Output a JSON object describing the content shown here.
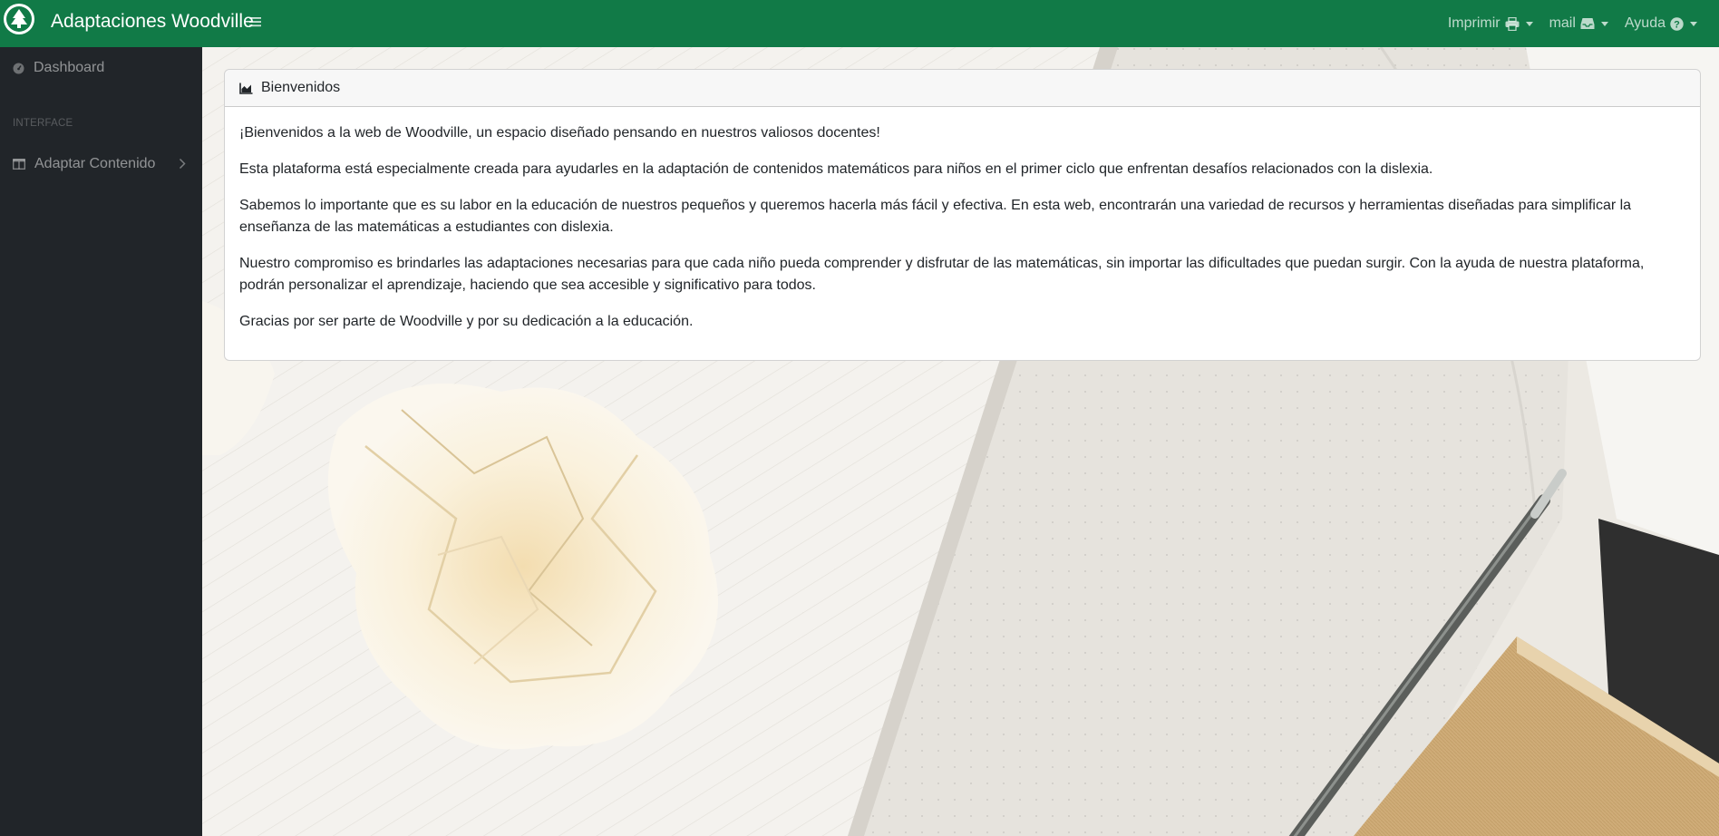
{
  "navbar": {
    "brand_title": "Adaptaciones Woodville",
    "logo_icon": "tree-logo-icon",
    "toggle_icon": "bars-icon",
    "color": "#117a47",
    "items": [
      {
        "label": "Imprimir",
        "icon": "printer-icon"
      },
      {
        "label": "mail",
        "icon": "inbox-icon"
      },
      {
        "label": "Ayuda",
        "icon": "question-circle-icon"
      }
    ]
  },
  "sidebar": {
    "dashboard_label": "Dashboard",
    "section_heading": "INTERFACE",
    "adaptar_label": "Adaptar Contenido"
  },
  "card": {
    "title": "Bienvenidos",
    "title_icon": "chart-area-icon",
    "paragraphs": [
      "¡Bienvenidos a la web de Woodville, un espacio diseñado pensando en nuestros valiosos docentes!",
      "Esta plataforma está especialmente creada para ayudarles en la adaptación de contenidos matemáticos para niños en el primer ciclo que enfrentan desafíos relacionados con la dislexia.",
      "Sabemos lo importante que es su labor en la educación de nuestros pequeños y queremos hacerla más fácil y efectiva. En esta web, encontrarán una variedad de recursos y herramientas diseñadas para simplificar la enseñanza de las matemáticas a estudiantes con dislexia.",
      "Nuestro compromiso es brindarles las adaptaciones necesarias para que cada niño pueda comprender y disfrutar de las matemáticas, sin importar las dificultades que puedan surgir. Con la ayuda de nuestra plataforma, podrán personalizar el aprendizaje, haciendo que sea accesible y significativo para todos.",
      "Gracias por ser parte de Woodville y por su dedicación a la educación."
    ]
  }
}
